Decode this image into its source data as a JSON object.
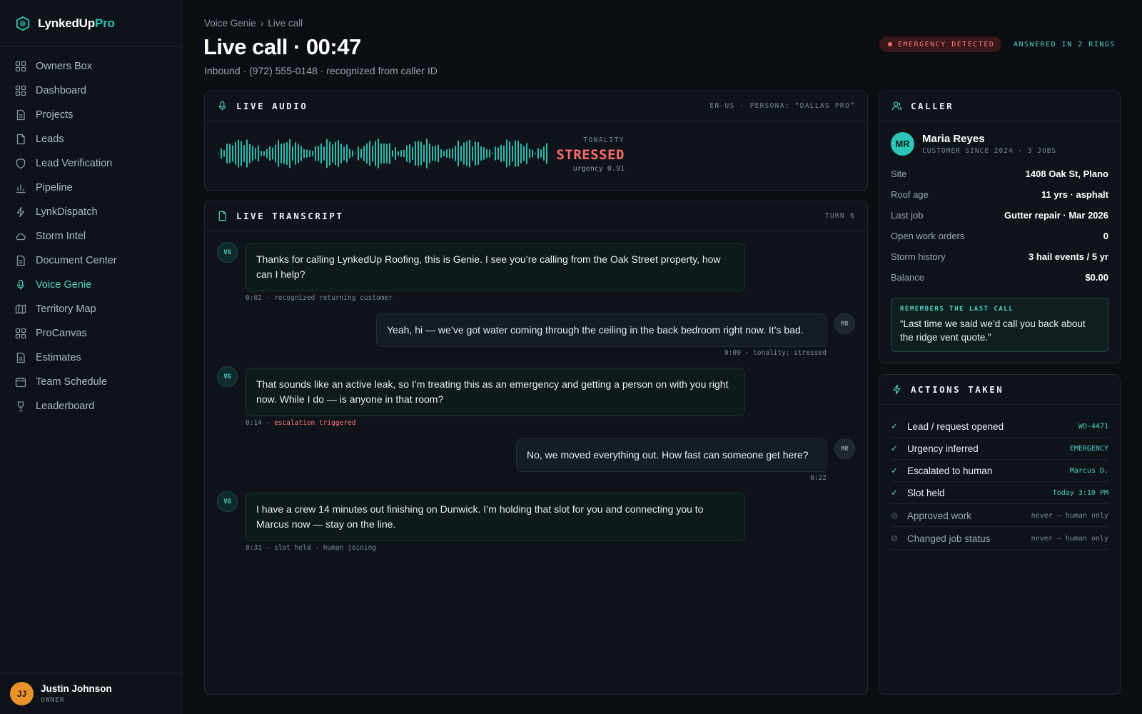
{
  "brand": {
    "name_part1": "LynkedUp",
    "name_part2": "Pro"
  },
  "sidebar": {
    "items": [
      {
        "label": "Owners Box",
        "icon": "grid-icon",
        "active": false
      },
      {
        "label": "Dashboard",
        "icon": "grid-icon",
        "active": false
      },
      {
        "label": "Projects",
        "icon": "document-icon",
        "active": false
      },
      {
        "label": "Leads",
        "icon": "file-icon",
        "active": false
      },
      {
        "label": "Lead Verification",
        "icon": "shield-icon",
        "active": false
      },
      {
        "label": "Pipeline",
        "icon": "bar-chart-icon",
        "active": false
      },
      {
        "label": "LynkDispatch",
        "icon": "lightning-icon",
        "active": false
      },
      {
        "label": "Storm Intel",
        "icon": "cloud-icon",
        "active": false
      },
      {
        "label": "Document Center",
        "icon": "document-icon",
        "active": false
      },
      {
        "label": "Voice Genie",
        "icon": "microphone-icon",
        "active": true
      },
      {
        "label": "Territory Map",
        "icon": "map-icon",
        "active": false
      },
      {
        "label": "ProCanvas",
        "icon": "grid-icon",
        "active": false
      },
      {
        "label": "Estimates",
        "icon": "document-icon",
        "active": false
      },
      {
        "label": "Team Schedule",
        "icon": "calendar-icon",
        "active": false
      },
      {
        "label": "Leaderboard",
        "icon": "trophy-icon",
        "active": false
      }
    ]
  },
  "user": {
    "initials": "JJ",
    "name": "Justin Johnson",
    "role": "OWNER"
  },
  "header": {
    "breadcrumb": [
      "Voice Genie",
      "Live call"
    ],
    "breadcrumb_sep": "›",
    "title": "Live call · 00:47",
    "subtitle": "Inbound · (972) 555-0148 · recognized from caller ID",
    "emergency_badge": "EMERGENCY DETECTED",
    "rings_badge": "ANSWERED IN 2 RINGS"
  },
  "audio": {
    "title": "LIVE AUDIO",
    "meta": "EN-US · PERSONA: “DALLAS PRO”",
    "tonality_label": "TONALITY",
    "tonality_value": "STRESSED",
    "urgency": "urgency 0.91"
  },
  "transcript": {
    "title": "LIVE TRANSCRIPT",
    "turn": "TURN 6",
    "messages": [
      {
        "speaker": "VG",
        "text": "Thanks for calling LynkedUp Roofing, this is Genie. I see you’re calling from the Oak Street property, how can I help?",
        "time": "0:02",
        "note": "recognized returning customer",
        "note_alert": false
      },
      {
        "speaker": "MR",
        "text": "Yeah, hi — we’ve got water coming through the ceiling in the back bedroom right now. It’s bad.",
        "time": "0:09",
        "note": "tonality: stressed",
        "note_alert": false
      },
      {
        "speaker": "VG",
        "text": "That sounds like an active leak, so I’m treating this as an emergency and getting a person on with you right now. While I do — is anyone in that room?",
        "time": "0:14",
        "note": "escalation triggered",
        "note_alert": true
      },
      {
        "speaker": "MR",
        "text": "No, we moved everything out. How fast can someone get here?",
        "time": "0:22",
        "note": "",
        "note_alert": false
      },
      {
        "speaker": "VG",
        "text": "I have a crew 14 minutes out finishing on Dunwick. I’m holding that slot for you and connecting you to Marcus now — stay on the line.",
        "time": "0:31",
        "note": "slot held · human joining",
        "note_alert": false
      }
    ]
  },
  "caller": {
    "title": "CALLER",
    "initials": "MR",
    "name": "Maria Reyes",
    "since": "CUSTOMER SINCE 2024 · 3 JOBS",
    "details": [
      {
        "label": "Site",
        "value": "1408 Oak St, Plano"
      },
      {
        "label": "Roof age",
        "value": "11 yrs · asphalt"
      },
      {
        "label": "Last job",
        "value": "Gutter repair · Mar 2026"
      },
      {
        "label": "Open work orders",
        "value": "0"
      },
      {
        "label": "Storm history",
        "value": "3 hail events / 5 yr"
      },
      {
        "label": "Balance",
        "value": "$0.00"
      }
    ],
    "memory_label": "REMEMBERS THE LAST CALL",
    "memory_text": "“Last time we said we’d call you back about the ridge vent quote.”"
  },
  "actions": {
    "title": "ACTIONS TAKEN",
    "items": [
      {
        "label": "Lead / request opened",
        "value": "WO-4471",
        "done": true
      },
      {
        "label": "Urgency inferred",
        "value": "EMERGENCY",
        "done": true
      },
      {
        "label": "Escalated to human",
        "value": "Marcus D.",
        "done": true
      },
      {
        "label": "Slot held",
        "value": "Today 3:10 PM",
        "done": true
      },
      {
        "label": "Approved work",
        "value": "never — human only",
        "done": false
      },
      {
        "label": "Changed job status",
        "value": "never — human only",
        "done": false
      }
    ]
  },
  "colors": {
    "accent": "#4fd1c5",
    "alert": "#ff6b6b",
    "background": "#0b0f14",
    "panel": "#0e1419"
  }
}
